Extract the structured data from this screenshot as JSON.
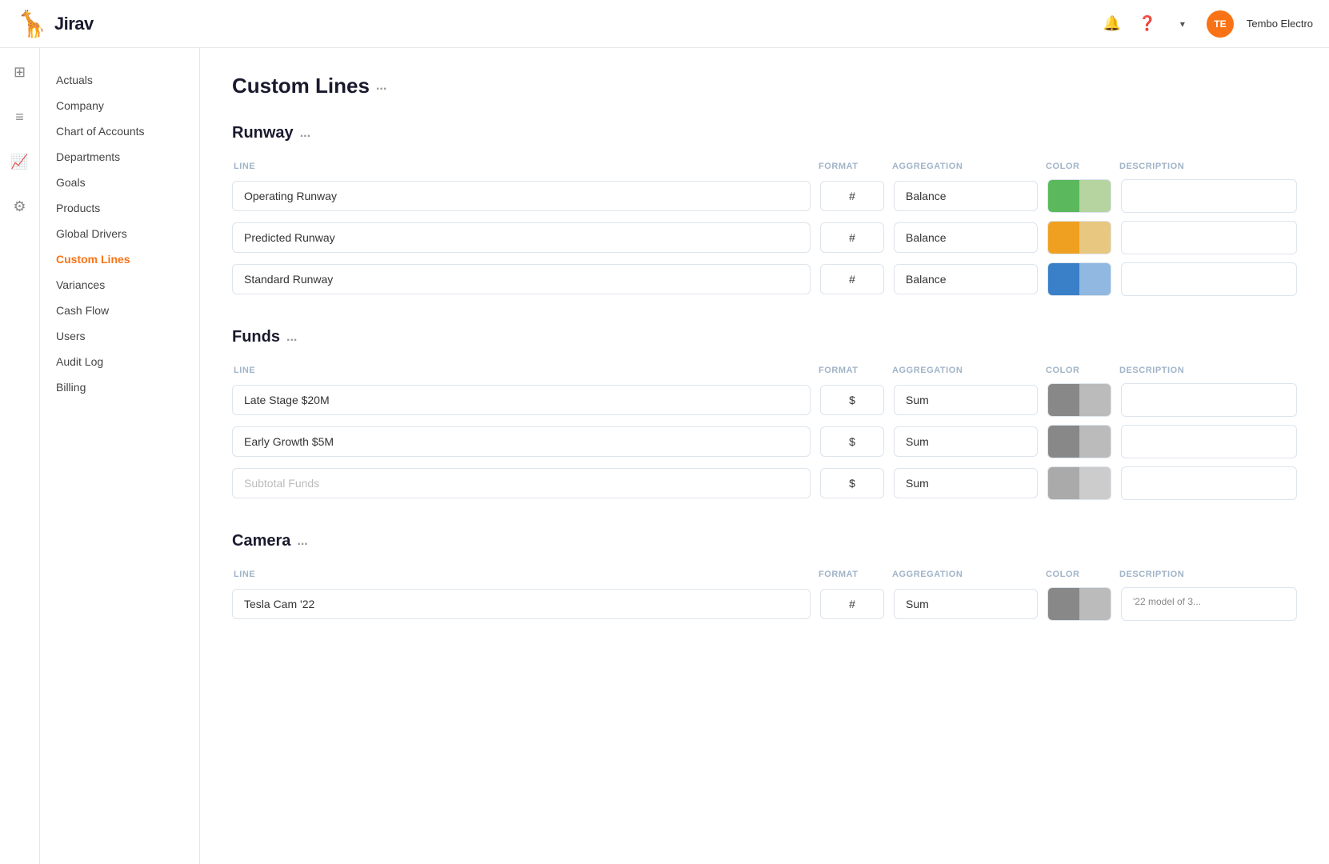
{
  "topbar": {
    "logo_text": "Jirav",
    "user_initials": "TE",
    "user_name": "Tembo Electro"
  },
  "sidebar": {
    "items": [
      {
        "id": "actuals",
        "label": "Actuals",
        "active": false
      },
      {
        "id": "company",
        "label": "Company",
        "active": false
      },
      {
        "id": "chart-of-accounts",
        "label": "Chart of Accounts",
        "active": false
      },
      {
        "id": "departments",
        "label": "Departments",
        "active": false
      },
      {
        "id": "goals",
        "label": "Goals",
        "active": false
      },
      {
        "id": "products",
        "label": "Products",
        "active": false
      },
      {
        "id": "global-drivers",
        "label": "Global Drivers",
        "active": false
      },
      {
        "id": "custom-lines",
        "label": "Custom Lines",
        "active": true
      },
      {
        "id": "variances",
        "label": "Variances",
        "active": false
      },
      {
        "id": "cash-flow",
        "label": "Cash Flow",
        "active": false
      },
      {
        "id": "users",
        "label": "Users",
        "active": false
      },
      {
        "id": "audit-log",
        "label": "Audit Log",
        "active": false
      },
      {
        "id": "billing",
        "label": "Billing",
        "active": false
      }
    ]
  },
  "page": {
    "title": "Custom Lines",
    "more": "..."
  },
  "sections": [
    {
      "id": "runway",
      "title": "Runway",
      "more": "...",
      "columns": {
        "line": "LINE",
        "format": "FORMAT",
        "aggregation": "AGGREGATION",
        "color": "COLOR",
        "description": "DESCRIPTION"
      },
      "rows": [
        {
          "id": "operating-runway",
          "line": "Operating Runway",
          "format": "#",
          "aggregation": "Balance",
          "color_l": "#5cb85c",
          "color_r": "#b5d4a0",
          "description": ""
        },
        {
          "id": "predicted-runway",
          "line": "Predicted Runway",
          "format": "#",
          "aggregation": "Balance",
          "color_l": "#f0a020",
          "color_r": "#e8c880",
          "description": ""
        },
        {
          "id": "standard-runway",
          "line": "Standard Runway",
          "format": "#",
          "aggregation": "Balance",
          "color_l": "#3a80c8",
          "color_r": "#90b8e0",
          "description": ""
        }
      ]
    },
    {
      "id": "funds",
      "title": "Funds",
      "more": "...",
      "columns": {
        "line": "LINE",
        "format": "FORMAT",
        "aggregation": "AGGREGATION",
        "color": "COLOR",
        "description": "DESCRIPTION"
      },
      "rows": [
        {
          "id": "late-stage",
          "line": "Late Stage $20M",
          "format": "$",
          "aggregation": "Sum",
          "color_l": "#888",
          "color_r": "#bbb",
          "description": "",
          "subtotal": false
        },
        {
          "id": "early-growth",
          "line": "Early Growth $5M",
          "format": "$",
          "aggregation": "Sum",
          "color_l": "#888",
          "color_r": "#bbb",
          "description": "",
          "subtotal": false
        },
        {
          "id": "subtotal-funds",
          "line": "Subtotal Funds",
          "format": "$",
          "aggregation": "Sum",
          "color_l": "#aaa",
          "color_r": "#ccc",
          "description": "",
          "subtotal": true
        }
      ]
    },
    {
      "id": "camera",
      "title": "Camera",
      "more": "...",
      "columns": {
        "line": "LINE",
        "format": "FORMAT",
        "aggregation": "AGGREGATION",
        "color": "COLOR",
        "description": "DESCRIPTION"
      },
      "rows": [
        {
          "id": "camera-row1",
          "line": "Tesla Cam '22",
          "format": "#",
          "aggregation": "Sum",
          "color_l": "#888",
          "color_r": "#bbb",
          "description": "'22 model of 3...",
          "subtotal": false
        }
      ]
    }
  ]
}
